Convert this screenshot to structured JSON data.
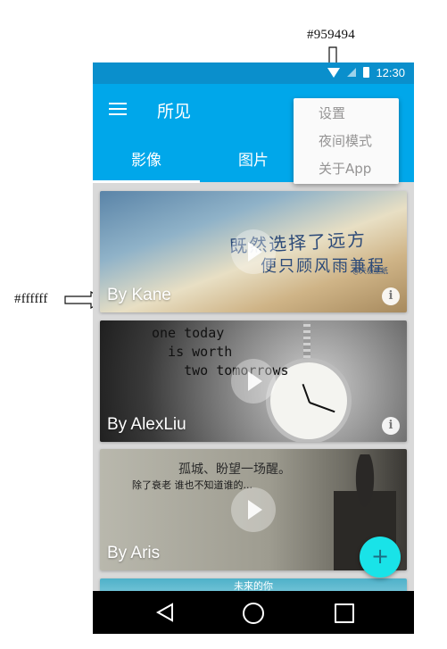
{
  "annotations": {
    "popup_color_label": "#959494",
    "author_color_label": "#ffffff"
  },
  "statusbar": {
    "time": "12:30",
    "icons": [
      "wifi-icon",
      "signal-icon",
      "battery-icon"
    ]
  },
  "appbar": {
    "title": "所见",
    "menu_icon": "menu-icon",
    "tabs": [
      {
        "label": "影像",
        "selected": true
      },
      {
        "label": "图片",
        "selected": false
      }
    ]
  },
  "overflow_menu": {
    "items": [
      "设置",
      "夜间模式",
      "关于App"
    ],
    "text_color": "#959494"
  },
  "cards": [
    {
      "author": "By Kane",
      "art_lines": [
        "既然选择了远方",
        "便只顾风雨兼程"
      ],
      "signature": "@天极壁纸"
    },
    {
      "author": "By AlexLiu",
      "art_lines": [
        "one today",
        "  is worth",
        "    two tomorrows"
      ]
    },
    {
      "author": "By Aris",
      "art_lines": [
        "孤城、盼望一场醒。",
        "除了衰老 谁也不知道谁的..."
      ]
    },
    {
      "author": "",
      "art_lines": [
        "未來的你"
      ]
    }
  ],
  "fab": {
    "label": "+"
  },
  "colors": {
    "status_bar": "#0a8fcc",
    "app_bar": "#00a7ea",
    "fab": "#19e3e8",
    "menu_text": "#959494",
    "author_text": "#ffffff"
  },
  "navbar": {
    "icons": [
      "back-icon",
      "home-icon",
      "recent-apps-icon"
    ]
  }
}
